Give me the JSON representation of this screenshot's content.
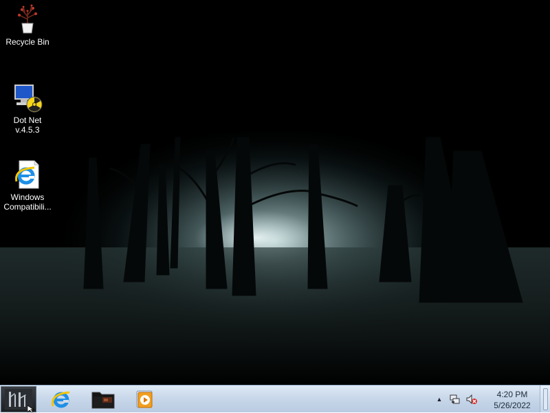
{
  "desktop": {
    "icons": [
      {
        "label": "Recycle Bin",
        "icon": "recycle-bin-icon"
      },
      {
        "label": "Dot Net\nv.4.5.3",
        "label_line1": "Dot Net",
        "label_line2": "v.4.5.3",
        "icon": "dotnet-installer-icon"
      },
      {
        "label_line1": "Windows",
        "label_line2": "Compatibili...",
        "icon": "internet-explorer-icon"
      }
    ],
    "wallpaper": "dark-foggy-forest"
  },
  "taskbar": {
    "start_icon": "start-orb-icon",
    "pinned": [
      {
        "name": "Internet Explorer",
        "icon": "internet-explorer-icon"
      },
      {
        "name": "Folder",
        "icon": "folder-icon"
      },
      {
        "name": "Windows Media Player",
        "icon": "media-player-icon"
      }
    ],
    "tray": {
      "show_hidden_icon": "chevron-up-icon",
      "network_icon": "network-icon",
      "volume_icon": "volume-muted-icon"
    },
    "clock": {
      "time": "4:20 PM",
      "date": "5/26/2022"
    }
  },
  "colors": {
    "taskbar_top": "#dfe9f5",
    "taskbar_bottom": "#b9cbe2",
    "desktop_text": "#ffffff",
    "ie_blue": "#1e90e6",
    "ie_ring": "#f5c400"
  }
}
